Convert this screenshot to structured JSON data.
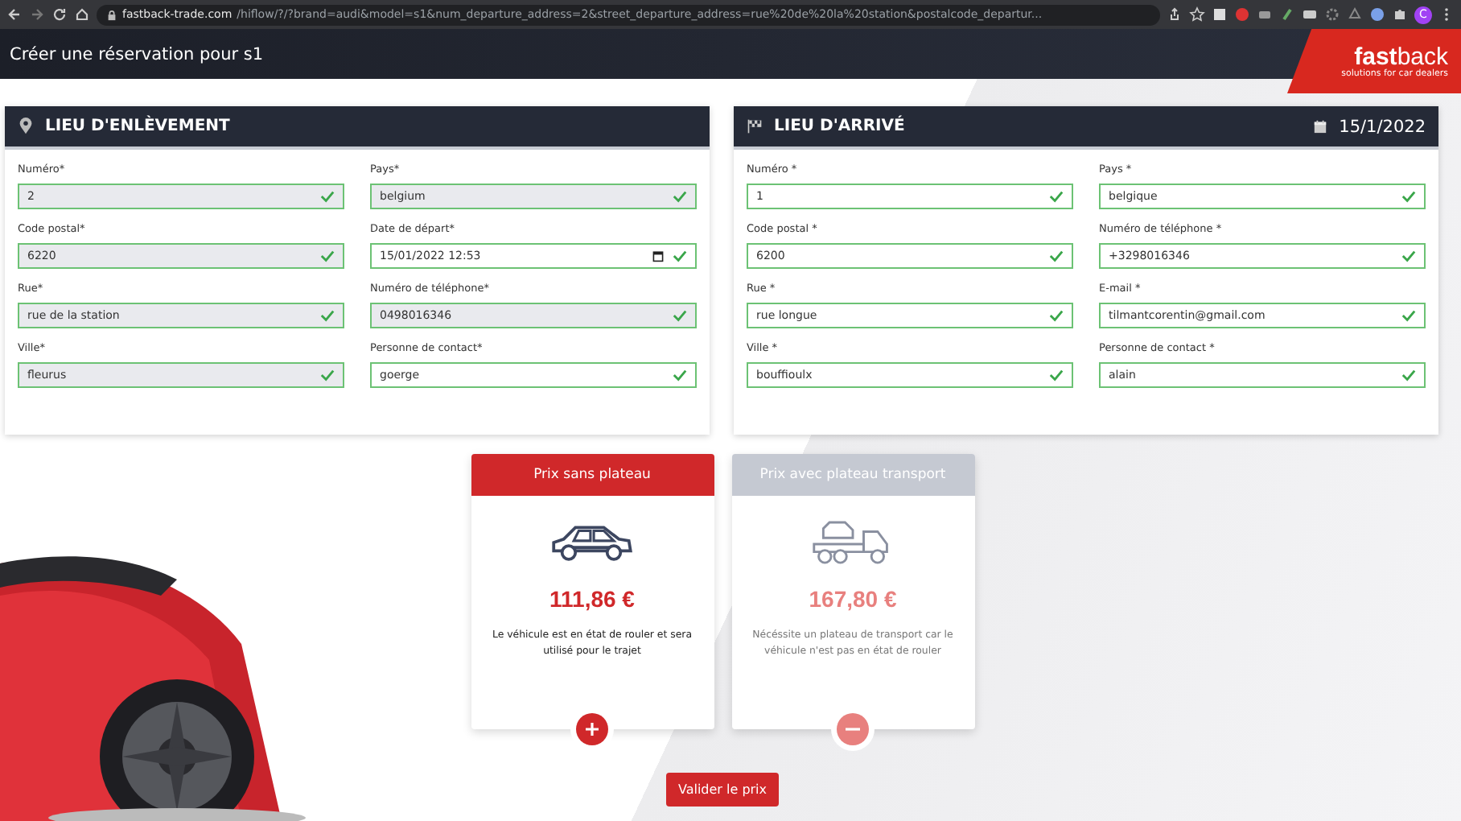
{
  "browser": {
    "url_host": "fastback-trade.com",
    "url_path": "/hiflow/?/?brand=audi&model=s1&num_departure_address=2&street_departure_address=rue%20de%20la%20station&postalcode_departur...",
    "profile": "C"
  },
  "header": {
    "title": "Créer une réservation pour s1",
    "logo": "**fast**back",
    "tagline": "solutions for car dealers"
  },
  "panels": [
    {
      "kind": "pickup",
      "title": "LIEU D'ENLÈVEMENT",
      "fields": [
        {
          "label": "Numéro*",
          "value": "2",
          "kind": "text",
          "readonly": true,
          "valid": true
        },
        {
          "label": "Pays*",
          "value": "belgium",
          "kind": "text",
          "readonly": true,
          "valid": true
        },
        {
          "label": "Code postal*",
          "value": "6220",
          "kind": "text",
          "readonly": true,
          "valid": true
        },
        {
          "label": "Date de départ*",
          "value": "15/01/2022 12:53",
          "kind": "datetime",
          "readonly": false,
          "valid": true
        },
        {
          "label": "Rue*",
          "value": "rue de la station",
          "kind": "text",
          "readonly": true,
          "valid": true
        },
        {
          "label": "Numéro de téléphone*",
          "value": "0498016346",
          "kind": "text",
          "readonly": true,
          "valid": true
        },
        {
          "label": "Ville*",
          "value": "fleurus",
          "kind": "text",
          "readonly": true,
          "valid": true
        },
        {
          "label": "Personne de contact*",
          "value": "goerge",
          "kind": "text",
          "readonly": false,
          "valid": true
        }
      ]
    },
    {
      "kind": "arrival",
      "title": "LIEU D'ARRIVÉ",
      "date": "15/1/2022",
      "fields": [
        {
          "label": "Numéro *",
          "value": "1",
          "kind": "text",
          "readonly": false,
          "valid": true
        },
        {
          "label": "Pays *",
          "value": "belgique",
          "kind": "text",
          "readonly": false,
          "valid": true
        },
        {
          "label": "Code postal *",
          "value": "6200",
          "kind": "text",
          "readonly": false,
          "valid": true
        },
        {
          "label": "Numéro de téléphone *",
          "value": "+3298016346",
          "kind": "text",
          "readonly": false,
          "valid": true
        },
        {
          "label": "Rue *",
          "value": "rue longue",
          "kind": "text",
          "readonly": false,
          "valid": true
        },
        {
          "label": "E-mail *",
          "value": "tilmantcorentin@gmail.com",
          "kind": "text",
          "readonly": false,
          "valid": true
        },
        {
          "label": "Ville *",
          "value": "bouffioulx",
          "kind": "text",
          "readonly": false,
          "valid": true
        },
        {
          "label": "Personne de contact *",
          "value": "alain",
          "kind": "text",
          "readonly": false,
          "valid": true
        }
      ]
    }
  ],
  "prices": [
    {
      "kind": "car",
      "title": "Prix sans plateau",
      "price": "111,86 €",
      "description": "Le véhicule est en état de rouler et sera utilisé pour le trajet",
      "selected": true
    },
    {
      "kind": "tow",
      "title": "Prix avec plateau transport",
      "price": "167,80 €",
      "description": "Nécéssite un plateau de transport car le véhicule n'est pas en état de rouler",
      "selected": false
    }
  ],
  "submit": "Valider le prix"
}
